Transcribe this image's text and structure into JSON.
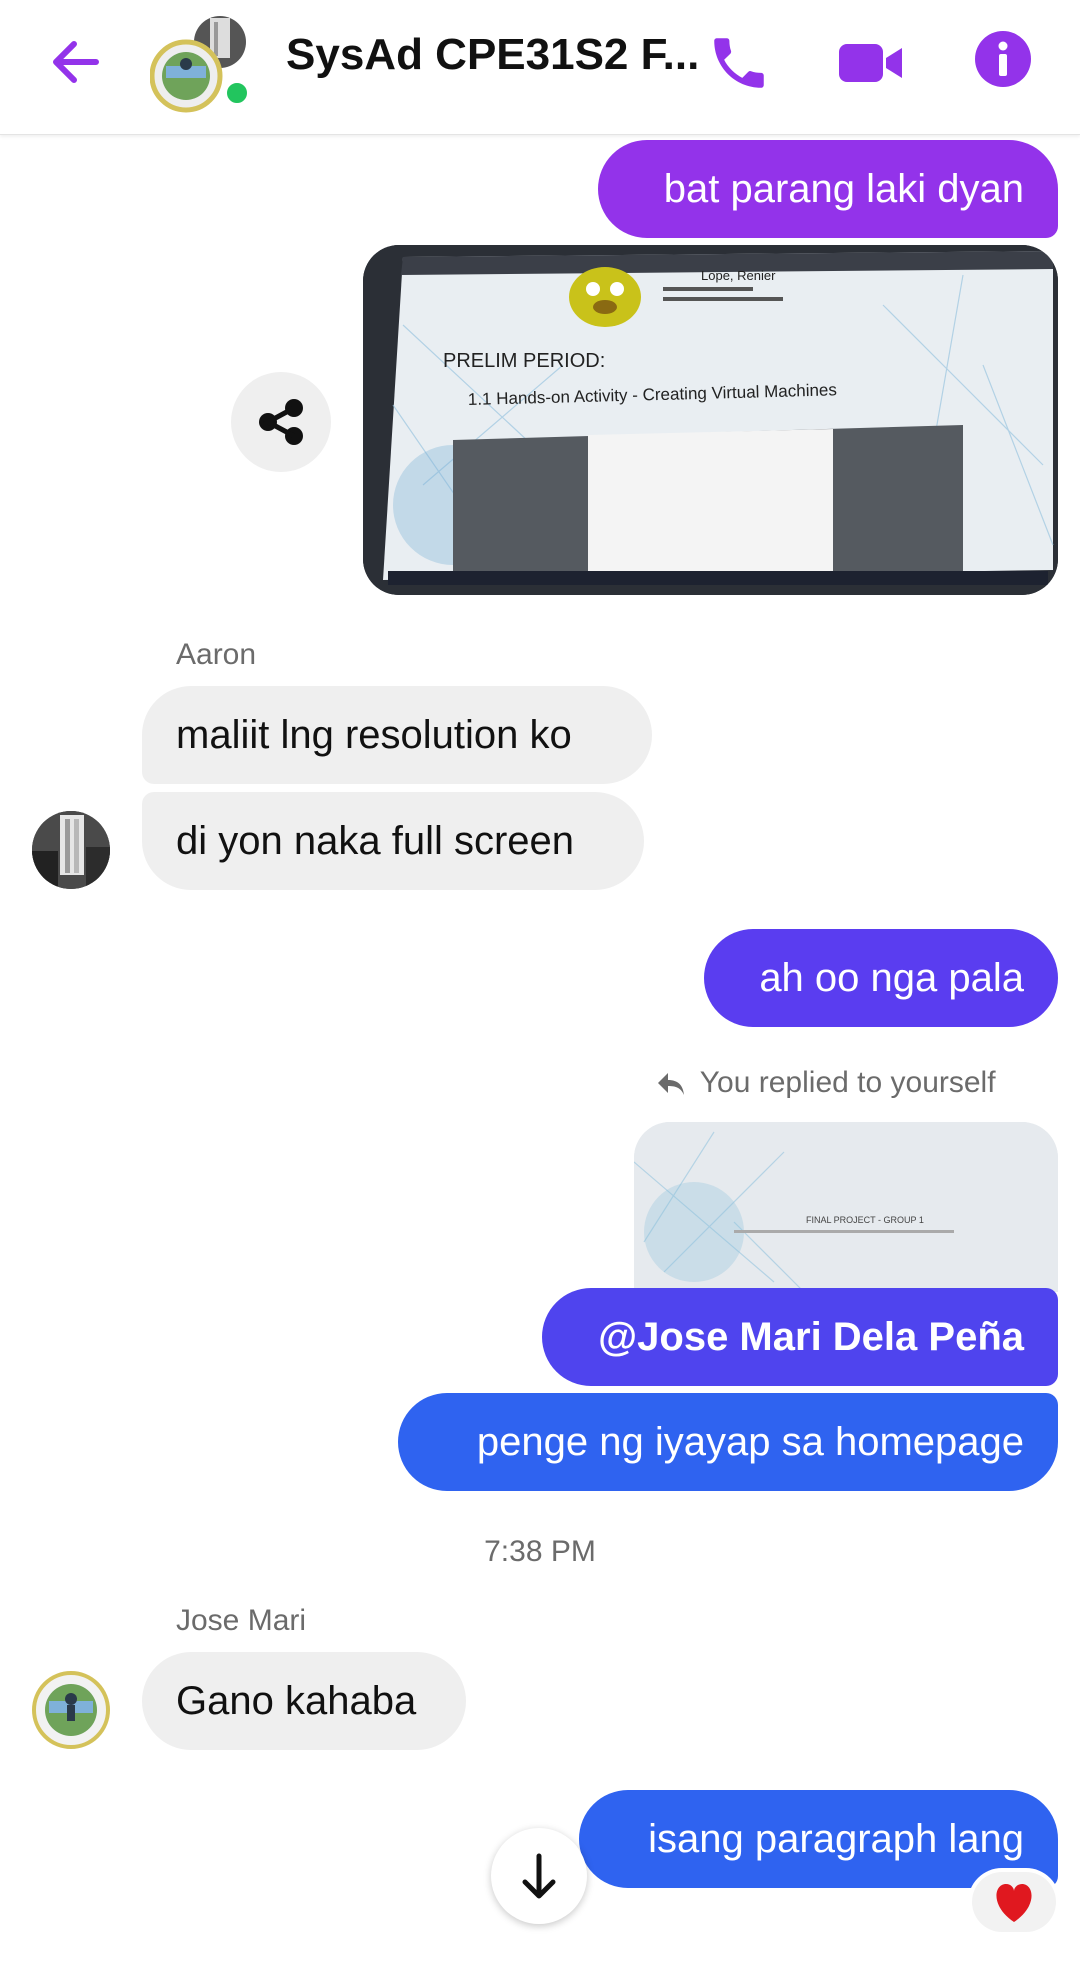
{
  "header": {
    "title": "SysAd CPE31S2 F...",
    "back_icon": "arrow-left-icon",
    "call_icon": "phone-icon",
    "video_icon": "video-camera-icon",
    "info_icon": "info-icon",
    "accent": "#9333ea",
    "online_color": "#22c55e"
  },
  "messages": [
    {
      "sender": "me",
      "text": "bat parang laki dyan"
    },
    {
      "sender": "me",
      "type": "image",
      "screen_text": {
        "name": "Lope, Renier",
        "period": "PRELIM PERIOD:",
        "activity": "1.1 Hands-on Activity - Creating Virtual Machines"
      }
    },
    {
      "sender": "Aaron",
      "text": "maliit lng resolution ko"
    },
    {
      "sender": "Aaron",
      "text": "di yon naka full screen"
    },
    {
      "sender": "me",
      "text": "ah oo nga pala"
    },
    {
      "sender": "me",
      "reply_label": "You replied to yourself",
      "type": "image",
      "screen_text": {
        "heading": "FINAL PROJECT - GROUP 1"
      }
    },
    {
      "sender": "me",
      "text": "@Jose Mari Dela Peña"
    },
    {
      "sender": "me",
      "text": "penge ng iyayap sa homepage"
    },
    {
      "type": "timestamp",
      "text": "7:38 PM"
    },
    {
      "sender": "Jose Mari",
      "text": "Gano kahaba"
    },
    {
      "sender": "me",
      "text": "isang paragraph lang",
      "reaction": "heart"
    }
  ],
  "names": {
    "aaron": "Aaron",
    "jose": "Jose Mari"
  },
  "controls": {
    "share_icon": "share-icon",
    "scroll_down_icon": "arrow-down-icon"
  }
}
